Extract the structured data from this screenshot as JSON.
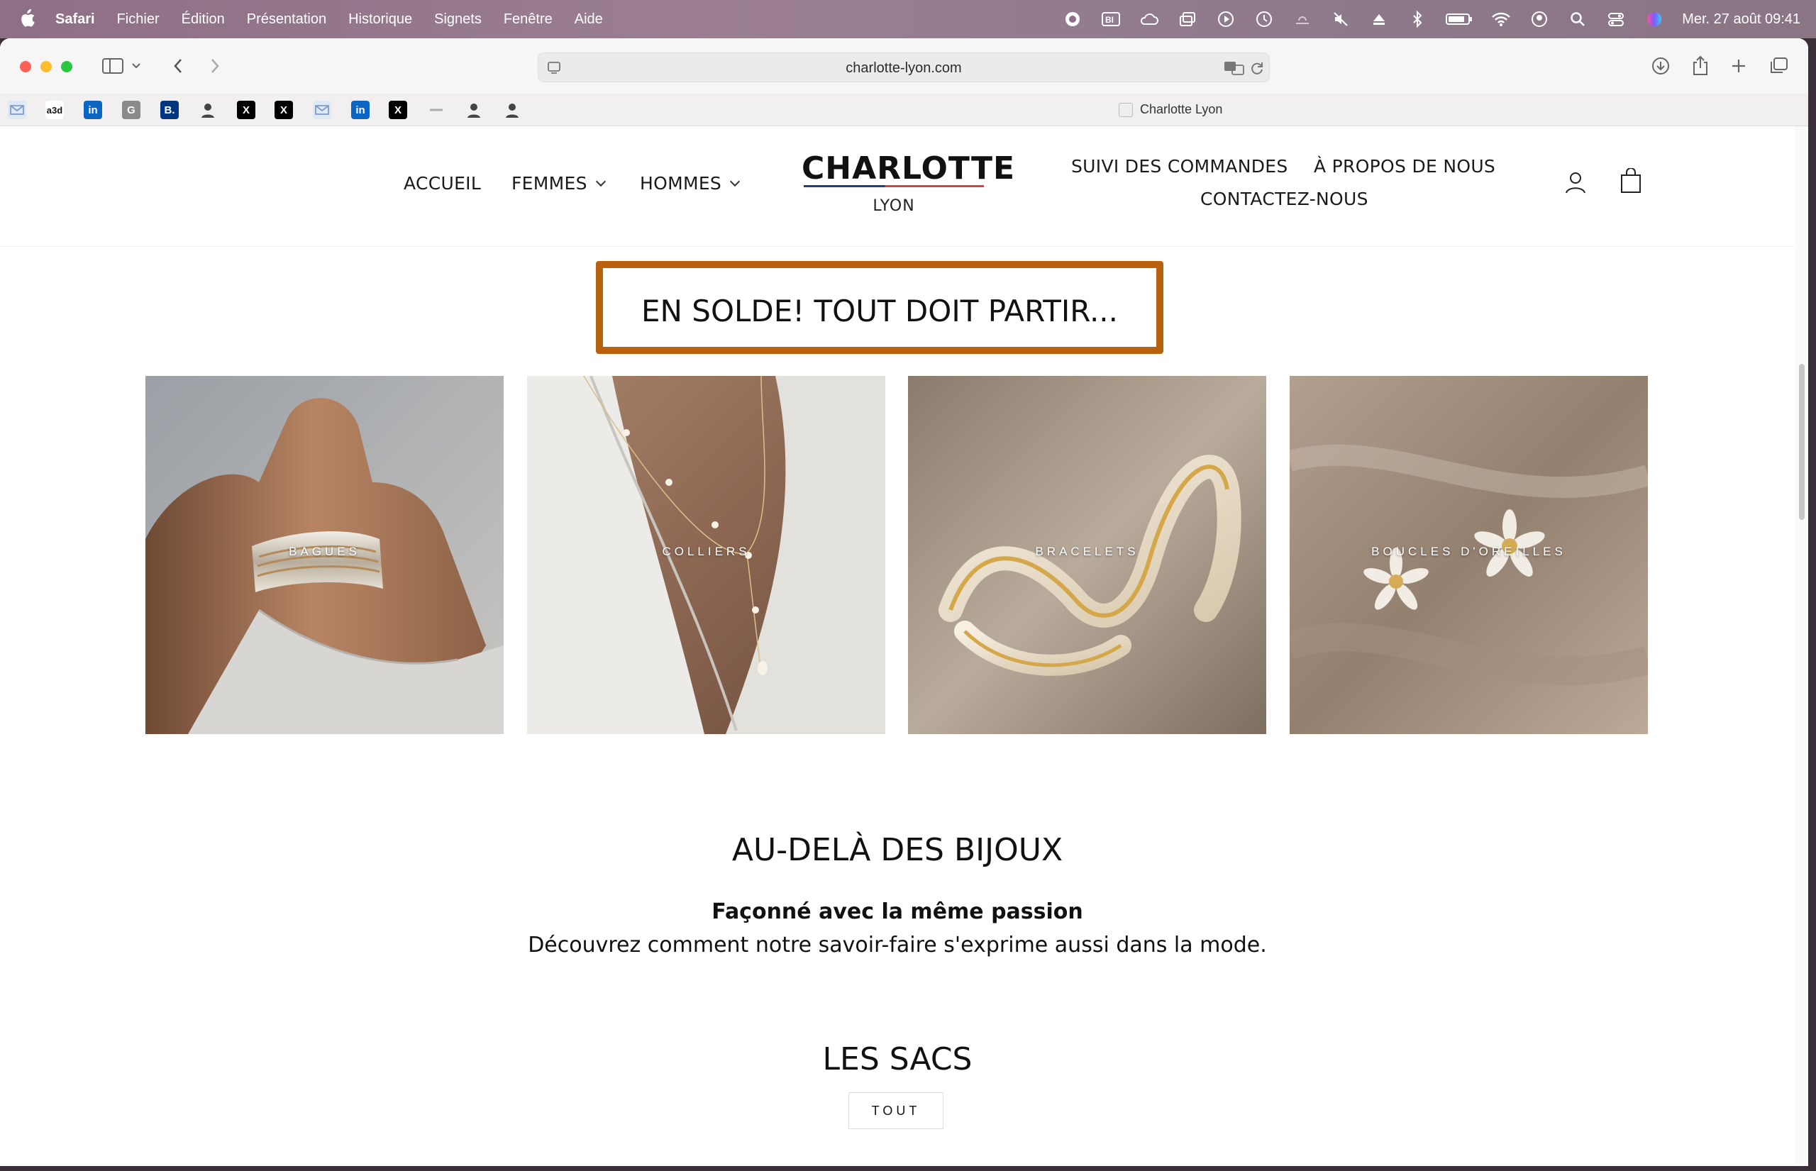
{
  "menubar": {
    "app": "Safari",
    "items": [
      "Fichier",
      "Édition",
      "Présentation",
      "Historique",
      "Signets",
      "Fenêtre",
      "Aide"
    ],
    "clock": "Mer. 27 août  09:41"
  },
  "browser": {
    "url": "charlotte-lyon.com",
    "tab_title": "Charlotte Lyon",
    "favorites": [
      {
        "icon": "mail-icon",
        "text": "",
        "color": "#a9c4e6"
      },
      {
        "icon": "a3d-icon",
        "text": "a3d",
        "color": "#ffffff"
      },
      {
        "icon": "linkedin-icon",
        "text": "in",
        "color": "#0a66c2"
      },
      {
        "icon": "g-icon",
        "text": "G",
        "color": "#7b7b7b"
      },
      {
        "icon": "booking-icon",
        "text": "B.",
        "color": "#003580"
      },
      {
        "icon": "avatar-icon",
        "text": "",
        "color": "#555555"
      },
      {
        "icon": "x-icon",
        "text": "X",
        "color": "#000000"
      },
      {
        "icon": "x-icon",
        "text": "X",
        "color": "#000000"
      },
      {
        "icon": "mail-icon",
        "text": "",
        "color": "#a9c4e6"
      },
      {
        "icon": "linkedin-icon",
        "text": "in",
        "color": "#0a66c2"
      },
      {
        "icon": "x-icon",
        "text": "X",
        "color": "#000000"
      },
      {
        "icon": "dash-icon",
        "text": "",
        "color": "#bbbbbb"
      },
      {
        "icon": "avatar-icon",
        "text": "",
        "color": "#555555"
      },
      {
        "icon": "avatar-icon",
        "text": "",
        "color": "#555555"
      }
    ]
  },
  "site": {
    "nav_left": [
      "ACCUEIL",
      "FEMMES",
      "HOMMES"
    ],
    "logo": {
      "name": "CHARLOTTE",
      "city": "LYON"
    },
    "nav_right": {
      "orders": "SUIVI DES COMMANDES",
      "about": "À PROPOS DE NOUS",
      "contact": "CONTACTEZ-NOUS"
    },
    "sale_banner": "EN SOLDE! TOUT DOIT PARTIR...",
    "categories": [
      "BAGUES",
      "COLLIERS",
      "BRACELETS",
      "BOUCLES D'OREILLES"
    ],
    "beyond": {
      "title": "AU-DELÀ DES BIJOUX",
      "subtitle": "Façonné avec la même passion",
      "description": "Découvrez comment notre savoir-faire s'exprime aussi dans la mode."
    },
    "bags": {
      "title": "LES SACS",
      "button": "TOUT"
    }
  },
  "colors": {
    "banner_border": "#b8620f",
    "logo_blue": "#1c3f8a",
    "logo_red": "#e43d3d"
  }
}
